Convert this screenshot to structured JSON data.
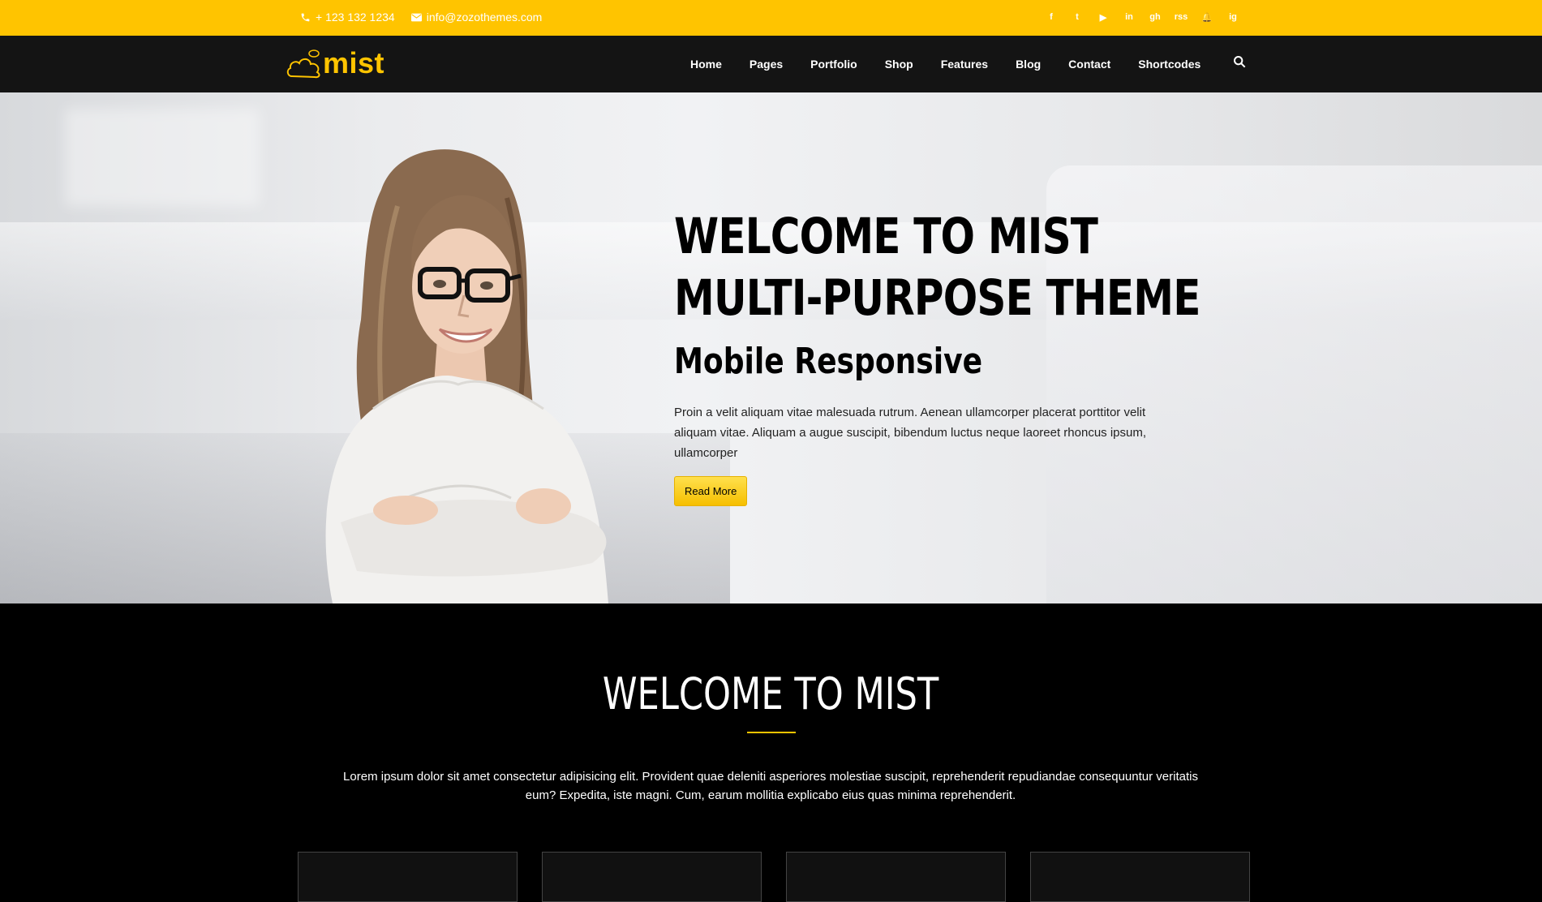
{
  "topbar": {
    "phone": "+ 123 132 1234",
    "email": "info@zozothemes.com",
    "social": [
      {
        "icon": "facebook-icon",
        "glyph": "f"
      },
      {
        "icon": "twitter-icon",
        "glyph": "t"
      },
      {
        "icon": "youtube-icon",
        "glyph": "▶"
      },
      {
        "icon": "linkedin-icon",
        "glyph": "in"
      },
      {
        "icon": "github-icon",
        "glyph": "gh"
      },
      {
        "icon": "wifi-icon",
        "glyph": "rss"
      },
      {
        "icon": "bell-icon",
        "glyph": "🔔"
      },
      {
        "icon": "instagram-icon",
        "glyph": "ig"
      }
    ]
  },
  "brand": {
    "name": "mist",
    "color": "#ffc400"
  },
  "nav": {
    "items": [
      "Home",
      "Pages",
      "Portfolio",
      "Shop",
      "Features",
      "Blog",
      "Contact",
      "Shortcodes"
    ]
  },
  "hero": {
    "title_line1": "WELCOME TO MIST",
    "title_line2": "MULTI-PURPOSE THEME",
    "subtitle": "Mobile Responsive",
    "body": "Proin a velit aliquam vitae malesuada rutrum. Aenean ullamcorper placerat porttitor velit aliquam vitae. Aliquam a augue suscipit, bibendum luctus neque laoreet rhoncus ipsum, ullamcorper",
    "button": "Read More"
  },
  "welcome": {
    "title": "WELCOME TO MIST",
    "body": "Lorem ipsum dolor sit amet consectetur adipisicing elit. Provident quae deleniti asperiores molestiae suscipit, reprehenderit repudiandae consequuntur veritatis eum? Expedita, iste magni. Cum, earum mollitia explicabo eius quas minima reprehenderit."
  },
  "colors": {
    "accent": "#ffc400",
    "nav_bg": "#141414",
    "section_bg": "#000000"
  }
}
